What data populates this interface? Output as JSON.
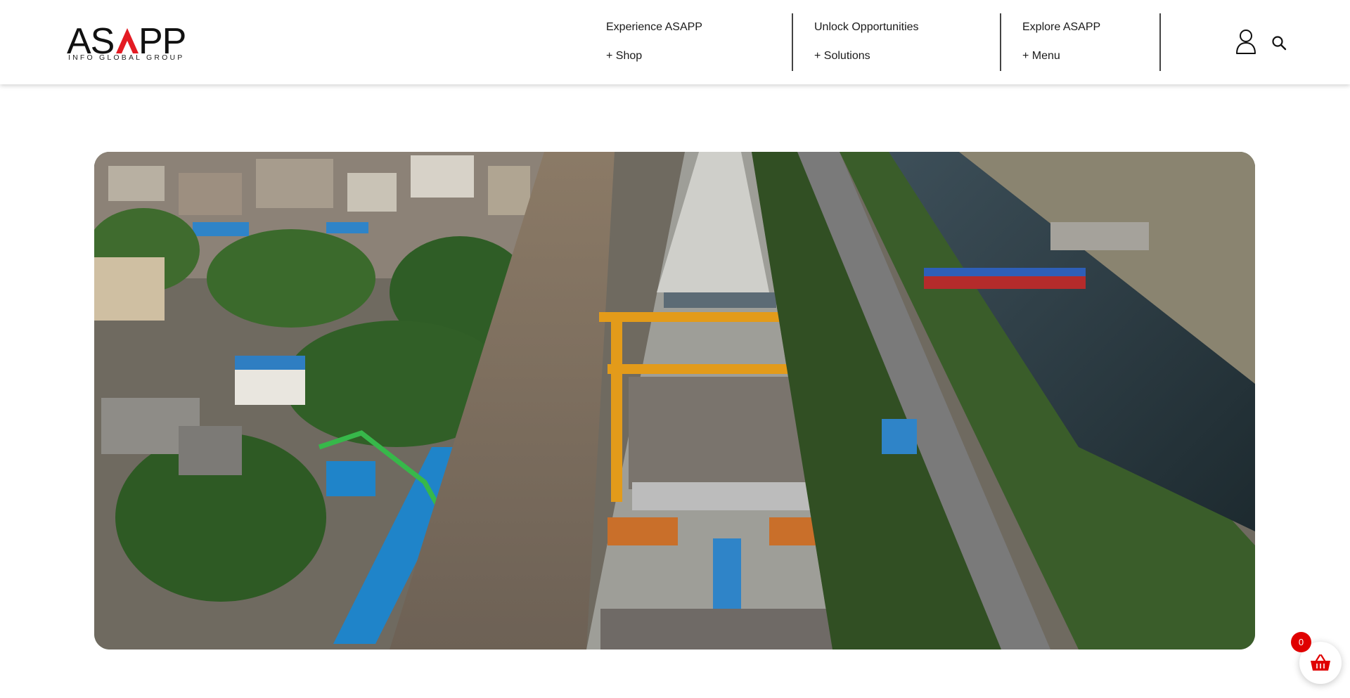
{
  "brand": {
    "logo_text": "ASAPP",
    "logo_subtext": "INFO GLOBAL GROUP",
    "accent_color": "#e31b23"
  },
  "nav": [
    {
      "title": "Experience ASAPP",
      "sub": "+ Shop"
    },
    {
      "title": "Unlock Opportunities",
      "sub": "+ Solutions"
    },
    {
      "title": "Explore ASAPP",
      "sub": "+ Menu"
    }
  ],
  "icons": {
    "account": "user-icon",
    "search": "search-icon",
    "cart": "basket-icon"
  },
  "hero": {
    "image": "aerial-construction-site-photo"
  },
  "cart": {
    "count": "0",
    "badge_color": "#e00000"
  }
}
